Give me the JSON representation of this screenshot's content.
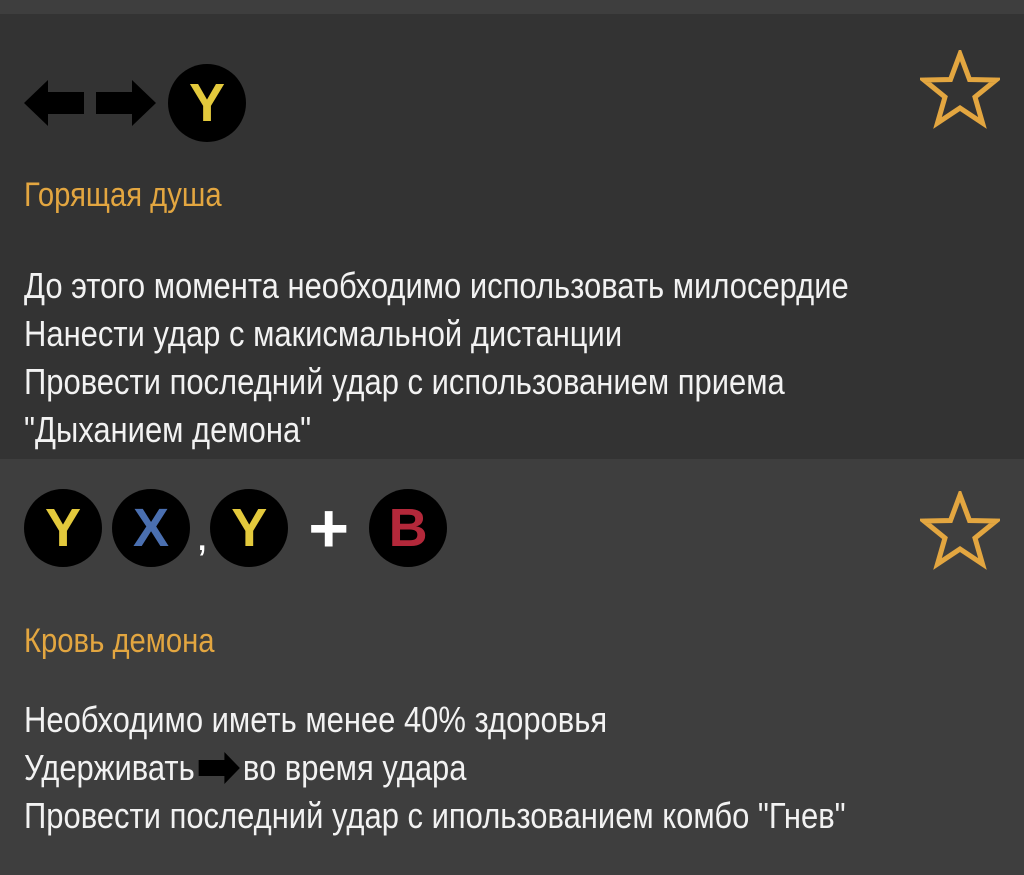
{
  "cards": [
    {
      "combo": [
        {
          "type": "arrow",
          "icon": "arrow-left-icon"
        },
        {
          "type": "arrow",
          "icon": "arrow-right-icon"
        },
        {
          "type": "button",
          "label": "Y",
          "color": "#e3c93c"
        }
      ],
      "favorite": {
        "icon": "star-outline-icon"
      },
      "title": "Горящая душа",
      "lines": [
        "До этого момента необходимо использовать милосердие",
        "Нанести удар с макисмальной дистанции",
        "Провести последний удар с использованием приема",
        "\"Дыханием демона\""
      ]
    },
    {
      "combo": [
        {
          "type": "button",
          "label": "Y",
          "color": "#e3c93c"
        },
        {
          "type": "button",
          "label": "X",
          "color": "#4a6fb0"
        },
        {
          "type": "separator",
          "label": ","
        },
        {
          "type": "button",
          "label": "Y",
          "color": "#e3c93c"
        },
        {
          "type": "separator",
          "label": "+"
        },
        {
          "type": "button",
          "label": "B",
          "color": "#b3283a"
        }
      ],
      "favorite": {
        "icon": "star-outline-icon"
      },
      "title": "Кровь демона",
      "lines": [
        "Необходимо иметь менее 40% здоровья",
        "Удерживать",
        "во время удара",
        "Провести последний удар с иполь­зованием комбо \"Гнев\""
      ]
    }
  ],
  "colors": {
    "accent": "#e3a640",
    "text": "#f2f2f2",
    "card_dark": "#333333",
    "card_light": "#3e3e3e"
  }
}
